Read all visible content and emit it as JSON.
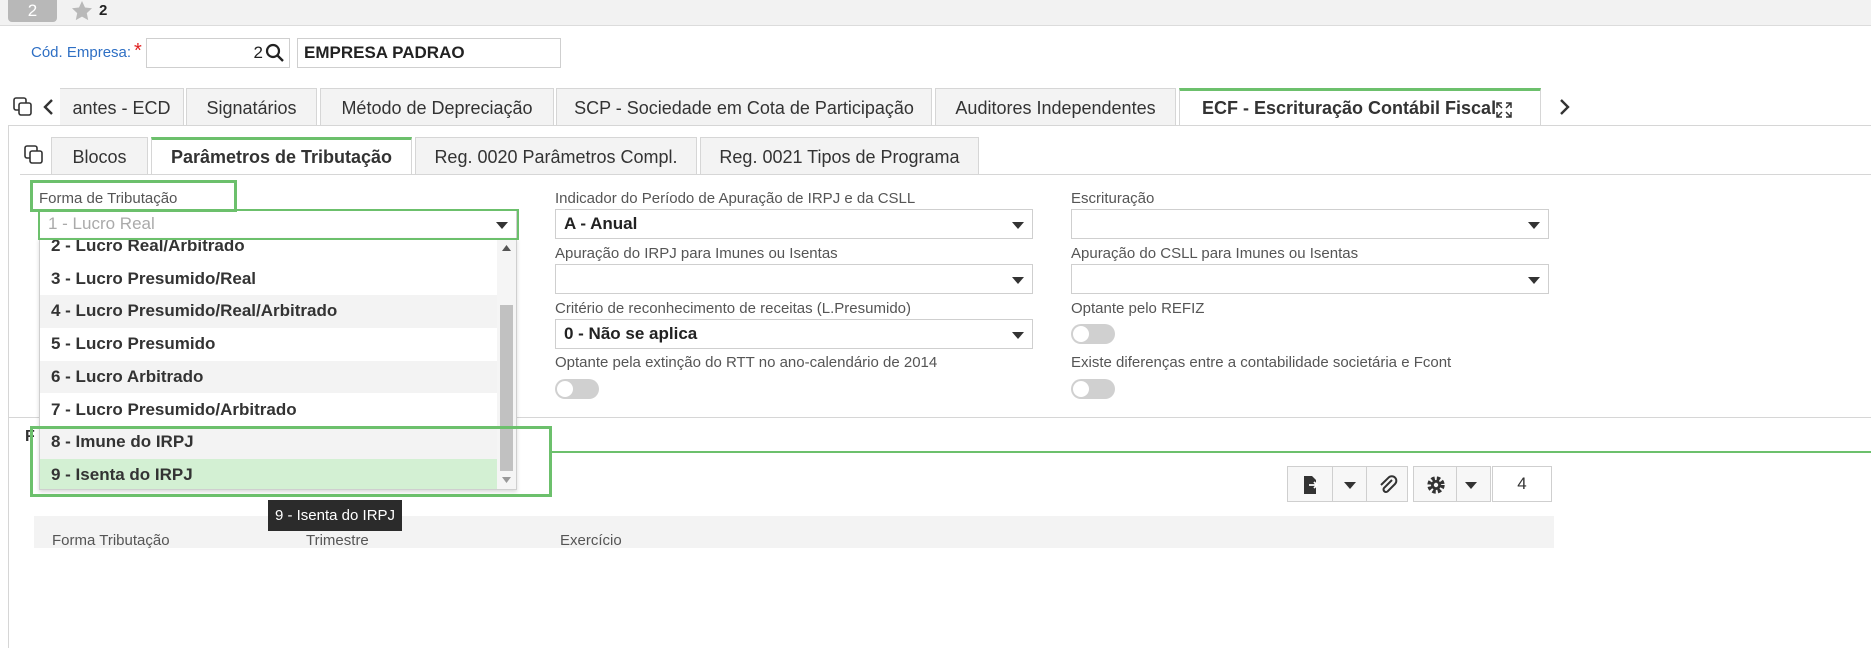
{
  "topbar": {
    "badge": "2",
    "fav_count": "2"
  },
  "company": {
    "label": "Cód. Empresa:",
    "required_mark": "*",
    "code": "2",
    "name": "EMPRESA PADRAO"
  },
  "main_tabs": [
    "antes - ECD",
    "Signatários",
    "Método de Depreciação",
    "SCP - Sociedade em Cota de Participação",
    "Auditores Independentes",
    "ECF - Escrituração Contábil Fiscal"
  ],
  "sub_tabs": [
    "Blocos",
    "Parâmetros de Tributação",
    "Reg. 0020 Parâmetros Compl.",
    "Reg. 0021 Tipos de Programa"
  ],
  "form": {
    "forma_label": "Forma de Tributação",
    "forma_value": "1 - Lucro Real",
    "indicador_label": "Indicador do Período de Apuração de IRPJ e da CSLL",
    "indicador_value": "A - Anual",
    "escrituracao_label": "Escrituração",
    "escrituracao_value": "",
    "apur_irpj_label": "Apuração do IRPJ para Imunes ou Isentas",
    "apur_irpj_value": "",
    "apur_csll_label": "Apuração do CSLL para Imunes ou Isentas",
    "apur_csll_value": "",
    "criterio_label": "Critério de reconhecimento de receitas (L.Presumido)",
    "criterio_value": "0 - Não se aplica",
    "refiz_label": "Optante pelo REFIZ",
    "rtt_label": "Optante pela extinção do RTT no ano-calendário de 2014",
    "fcont_label": "Existe diferenças entre a contabilidade societária e Fcont"
  },
  "dropdown_options": [
    "2 - Lucro Real/Arbitrado",
    "3 - Lucro Presumido/Real",
    "4 - Lucro Presumido/Real/Arbitrado",
    "5 - Lucro Presumido",
    "6 - Lucro Arbitrado",
    "7 - Lucro Presumido/Arbitrado",
    "8 - Imune do IRPJ",
    "9 - Isenta do IRPJ"
  ],
  "grid": {
    "title_fragment": "F",
    "row_count": "4",
    "headers": [
      "Forma Tributação",
      "Trimestre",
      "Exercício"
    ]
  },
  "tooltip": "9 - Isenta do IRPJ",
  "colors": {
    "accent_green": "#6cc06c",
    "link_blue": "#2e6fc4",
    "required_red": "#e02020"
  }
}
